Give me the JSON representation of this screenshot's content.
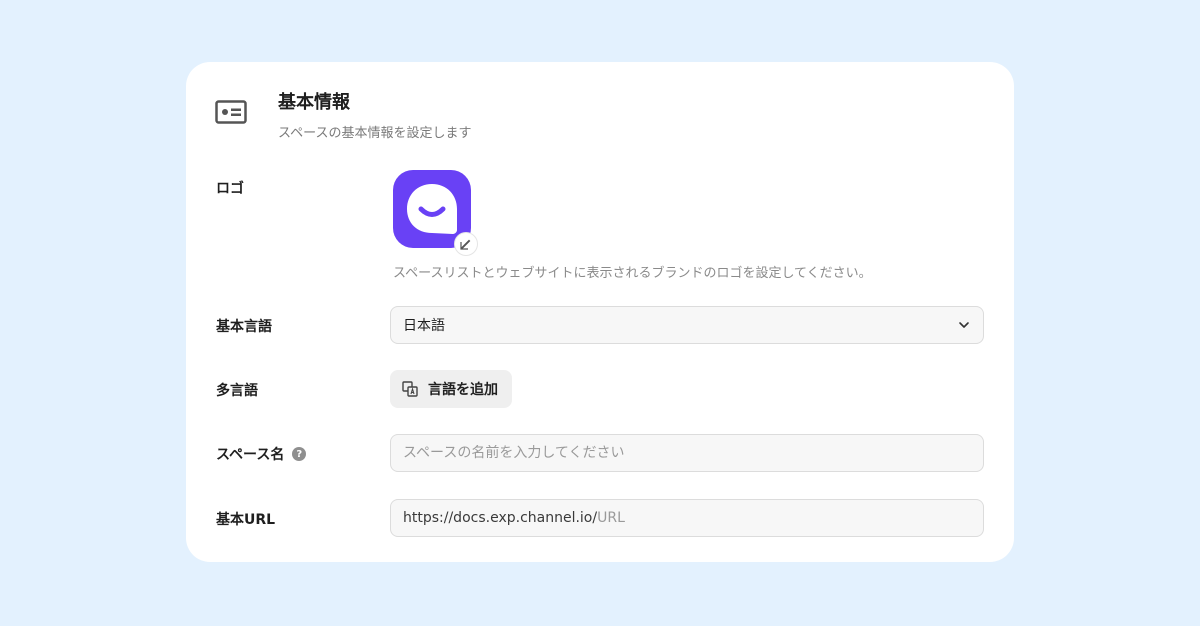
{
  "header": {
    "title": "基本情報",
    "subtitle": "スペースの基本情報を設定します",
    "icon": "id-card-icon"
  },
  "logo": {
    "label": "ロゴ",
    "hint": "スペースリストとウェブサイトに表示されるブランドのロゴを設定してください。",
    "brand_color": "#6941f5",
    "edit_icon": "edit-icon"
  },
  "language": {
    "label": "基本言語",
    "selected": "日本語"
  },
  "multilang": {
    "label": "多言語",
    "button_label": "言語を追加",
    "icon": "translate-icon"
  },
  "space_name": {
    "label": "スペース名",
    "placeholder": "スペースの名前を入力してください",
    "help_icon": "help-icon"
  },
  "base_url": {
    "label": "基本URL",
    "prefix": "https://docs.exp.channel.io/",
    "placeholder": "URL"
  },
  "colors": {
    "page_background": "#e3f1fe",
    "card_background": "#ffffff",
    "accent": "#6941f5"
  }
}
